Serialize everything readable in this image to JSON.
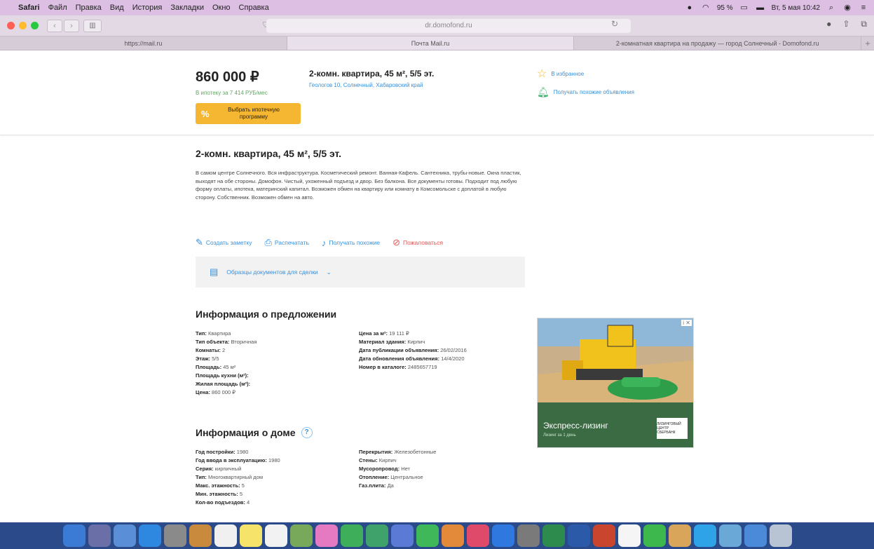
{
  "menubar": {
    "app": "Safari",
    "items": [
      "Файл",
      "Правка",
      "Вид",
      "История",
      "Закладки",
      "Окно",
      "Справка"
    ],
    "battery": "95 %",
    "datetime": "Вт, 5 мая 10:42"
  },
  "toolbar": {
    "address": "dr.domofond.ru"
  },
  "tabs": [
    {
      "label": "https://mail.ru",
      "active": false
    },
    {
      "label": "Почта Mail.ru",
      "active": true
    },
    {
      "label": "2-комнатная квартира на продажу — город Солнечный - Domofond.ru",
      "active": false
    }
  ],
  "header": {
    "price": "860 000 ₽",
    "mortgage_text": "В ипотеку за 7 414 РУБ/мес",
    "mortgage_button": "Выбрать ипотечную программу",
    "mortgage_icon": "%",
    "title": "2-комн. квартира, 45 м², 5/5 эт.",
    "address": "Геологов 10, Солнечный, Хабаровский край",
    "favorites": "В избранное",
    "get_similar": "Получать похожие объявления"
  },
  "listing": {
    "title": "2-комн. квартира, 45 м², 5/5 эт.",
    "description": "В самом центре Солнечного. Вся инфраструктура. Косметический ремонт. Ванная-Кафель. Сантехника, трубы-новые. Окна пластик, выходят на обе стороны. Домофон. Чистый, ухоженный подъезд и двор. Без балкона. Все документы готовы. Подходит под любую форму оплаты, ипотека, материнский капитал. Возможен обмен на квартиру или комнату в Комсомольске с доплатой в любую сторону. Собственник. Возможен обмен на авто."
  },
  "actions": {
    "note": "Создать заметку",
    "print": "Распечатать",
    "similar": "Получать похожие",
    "complain": "Пожаловаться"
  },
  "docs": {
    "label": "Образцы документов для сделки"
  },
  "offer": {
    "title": "Информация о предложении",
    "left": [
      {
        "k": "Тип:",
        "v": "Квартира"
      },
      {
        "k": "Тип объекта:",
        "v": "Вторичная"
      },
      {
        "k": "Комнаты:",
        "v": "2"
      },
      {
        "k": "Этаж:",
        "v": "5/5"
      },
      {
        "k": "Площадь:",
        "v": "45 м²"
      },
      {
        "k": "Площадь кухни (м²):",
        "v": ""
      },
      {
        "k": "Жилая площадь (м²):",
        "v": ""
      },
      {
        "k": "Цена:",
        "v": "860 000 ₽"
      }
    ],
    "right": [
      {
        "k": "Цена за м²:",
        "v": "19 111 ₽"
      },
      {
        "k": "Материал здания:",
        "v": "Кирпич"
      },
      {
        "k": "Дата публикации объявления:",
        "v": "26/02/2016"
      },
      {
        "k": "Дата обновления объявления:",
        "v": "14/4/2020"
      },
      {
        "k": "Номер в каталоге:",
        "v": "2485657719"
      }
    ]
  },
  "house": {
    "title": "Информация о доме",
    "help": "?",
    "left": [
      {
        "k": "Год постройки:",
        "v": "1980"
      },
      {
        "k": "Год ввода в эксплуатацию:",
        "v": "1980"
      },
      {
        "k": "Серия:",
        "v": "кирпичный"
      },
      {
        "k": "Тип:",
        "v": "Многоквартирный дом"
      },
      {
        "k": "Макс. этажность:",
        "v": "5"
      },
      {
        "k": "Мин. этажность:",
        "v": "5"
      },
      {
        "k": "Кол-во подъездов:",
        "v": "4"
      }
    ],
    "right": [
      {
        "k": "Перекрытия:",
        "v": "Железобетонные"
      },
      {
        "k": "Стены:",
        "v": "Кирпич"
      },
      {
        "k": "Мусоропровод:",
        "v": "Нет"
      },
      {
        "k": "Отопление:",
        "v": "Центральное"
      },
      {
        "k": "Газ.плита:",
        "v": "Да"
      }
    ]
  },
  "ad": {
    "flag": "i ✕",
    "text": "Экспресс-лизинг",
    "sub": "Лизинг за 1 день",
    "logo": "ЛИЗИНГОВЫЙ ЦЕНТР СБЕРБАНК"
  }
}
